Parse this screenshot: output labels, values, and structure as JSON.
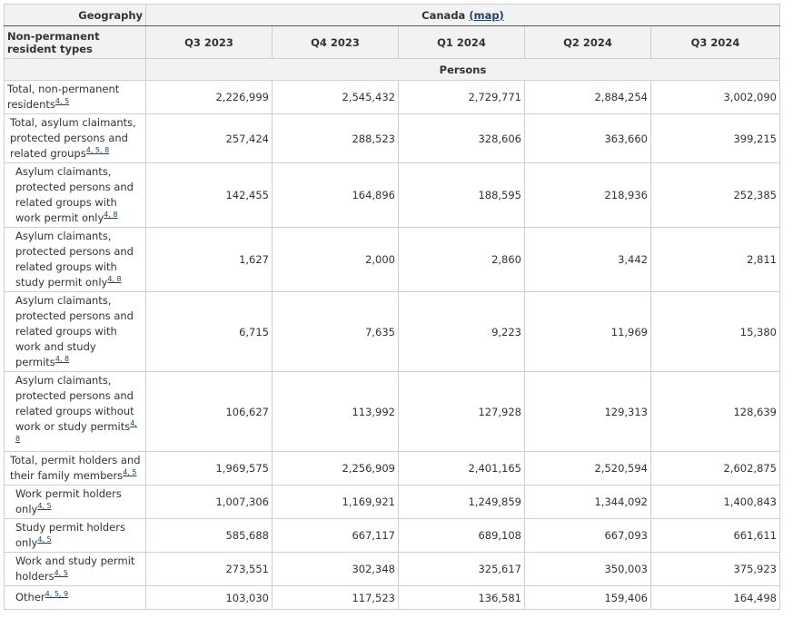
{
  "header": {
    "geography_label": "Geography",
    "location": "Canada",
    "map_link": "(map)",
    "row_header": "Non-permanent resident types",
    "columns": [
      "Q3 2023",
      "Q4 2023",
      "Q1 2024",
      "Q2 2024",
      "Q3 2024"
    ],
    "unit": "Persons"
  },
  "rows": [
    {
      "label": "Total, non-permanent residents",
      "notes": "4, 5",
      "values": [
        "2,226,999",
        "2,545,432",
        "2,729,771",
        "2,884,254",
        "3,002,090"
      ]
    },
    {
      "label": "Total, asylum claimants, protected persons and related groups",
      "notes": "4, 5, 8",
      "values": [
        "257,424",
        "288,523",
        "328,606",
        "363,660",
        "399,215"
      ]
    },
    {
      "label": "Asylum claimants, protected persons and related groups with work permit only",
      "notes": "4, 8",
      "values": [
        "142,455",
        "164,896",
        "188,595",
        "218,936",
        "252,385"
      ]
    },
    {
      "label": "Asylum claimants, protected persons and related groups with study permit only",
      "notes": "4, 8",
      "values": [
        "1,627",
        "2,000",
        "2,860",
        "3,442",
        "2,811"
      ]
    },
    {
      "label": "Asylum claimants, protected persons and related groups with work and study permits",
      "notes": "4, 8",
      "values": [
        "6,715",
        "7,635",
        "9,223",
        "11,969",
        "15,380"
      ]
    },
    {
      "label": "Asylum claimants, protected persons and related groups without work or study permits",
      "notes": "4, 8",
      "values": [
        "106,627",
        "113,992",
        "127,928",
        "129,313",
        "128,639"
      ]
    },
    {
      "label": "Total, permit holders and their family members",
      "notes": "4, 5",
      "values": [
        "1,969,575",
        "2,256,909",
        "2,401,165",
        "2,520,594",
        "2,602,875"
      ]
    },
    {
      "label": "Work permit holders only",
      "notes": "4, 5",
      "values": [
        "1,007,306",
        "1,169,921",
        "1,249,859",
        "1,344,092",
        "1,400,843"
      ]
    },
    {
      "label": "Study permit holders only",
      "notes": "4, 5",
      "values": [
        "585,688",
        "667,117",
        "689,108",
        "667,093",
        "661,611"
      ]
    },
    {
      "label": "Work and study permit holders",
      "notes": "4, 5",
      "values": [
        "273,551",
        "302,348",
        "325,617",
        "350,003",
        "375,923"
      ]
    },
    {
      "label": "Other",
      "notes": "4, 5, 9",
      "values": [
        "103,030",
        "117,523",
        "136,581",
        "159,406",
        "164,498"
      ]
    }
  ]
}
